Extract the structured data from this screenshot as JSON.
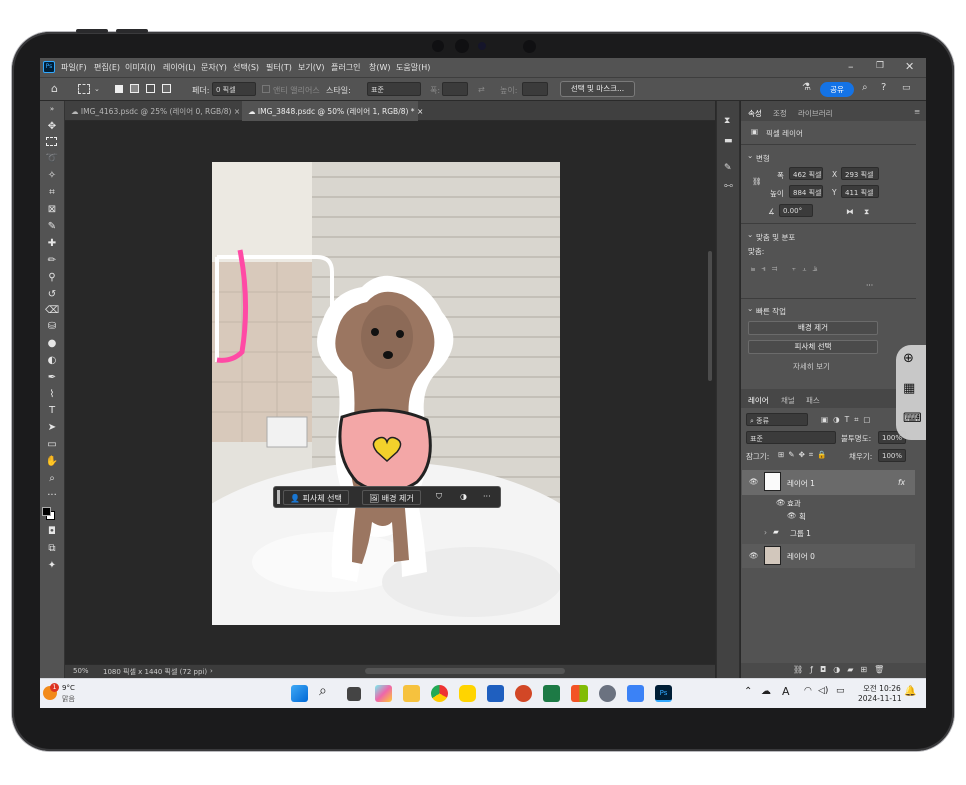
{
  "menu": {
    "app_icon": "Ps",
    "items": [
      "파일(F)",
      "편집(E)",
      "이미지(I)",
      "레이어(L)",
      "문자(Y)",
      "선택(S)",
      "필터(T)",
      "보기(V)",
      "플러그인",
      "창(W)",
      "도움말(H)"
    ],
    "window_controls": [
      "–",
      "❐",
      "✕"
    ]
  },
  "options": {
    "feather_label": "페더:",
    "feather_value": "0 픽셀",
    "antialias_label": "앤티 앨리어스",
    "style_label": "스타일:",
    "style_value": "표준",
    "width_label": "폭:",
    "height_label": "높이:",
    "select_mask_button": "선택 및 마스크...",
    "share_button": "공유"
  },
  "doc_tabs": [
    {
      "label": "IMG_4163.psdc @ 25% (레이어 0, RGB/8)",
      "close": "×"
    },
    {
      "label": "IMG_3848.psdc @ 50% (레이어 1, RGB/8) *",
      "close": "×"
    }
  ],
  "status": {
    "zoom": "50%",
    "info": "1080 픽셀 x 1440 픽셀 (72 ppi)",
    "arrow": "›"
  },
  "context_bar": {
    "subject": "피사체 선택",
    "remove_bg": "배경 제거",
    "more": "···"
  },
  "properties": {
    "tabs": [
      "속성",
      "조정",
      "라이브러리"
    ],
    "kind": "픽셀 레이어",
    "transform_title": "변형",
    "w_label": "폭",
    "w_value": "462 픽셀",
    "x_label": "X",
    "x_value": "293 픽셀",
    "h_label": "높이",
    "h_value": "884 픽셀",
    "y_label": "Y",
    "y_value": "411 픽셀",
    "angle_value": "0.00°",
    "align_title": "맞춤 및 분포",
    "align_label": "맞춤:",
    "ellipsis": "···",
    "quick_title": "빠른 작업",
    "quick_buttons": [
      "배경 제거",
      "피사체 선택"
    ],
    "more_link": "자세히 보기"
  },
  "layers": {
    "tabs": [
      "레이어",
      "채널",
      "패스"
    ],
    "filter_value": "종류",
    "blend_value": "표준",
    "opacity_label": "불투명도:",
    "opacity_value": "100%",
    "lock_label": "잠그기:",
    "fill_label": "채우기:",
    "fill_value": "100%",
    "items": [
      {
        "name": "레이어 1",
        "fx": "fx"
      },
      {
        "name": "효과"
      },
      {
        "name": "획"
      },
      {
        "name": "그룹 1"
      },
      {
        "name": "레이어 0"
      }
    ],
    "footer_icons": [
      "link-icon",
      "fx-icon",
      "mask-icon",
      "adjust-icon",
      "folder-icon",
      "new-layer-icon",
      "trash-icon"
    ]
  },
  "taskbar": {
    "weather_temp": "9°C",
    "weather_desc": "맑음",
    "weather_badge": "1",
    "ime": "A",
    "time": "오전 10:26",
    "date": "2024-11-11",
    "ps_label": "Ps"
  },
  "colors": {
    "accent": "#1473e6",
    "panel": "#535353",
    "canvas": "#282828"
  }
}
